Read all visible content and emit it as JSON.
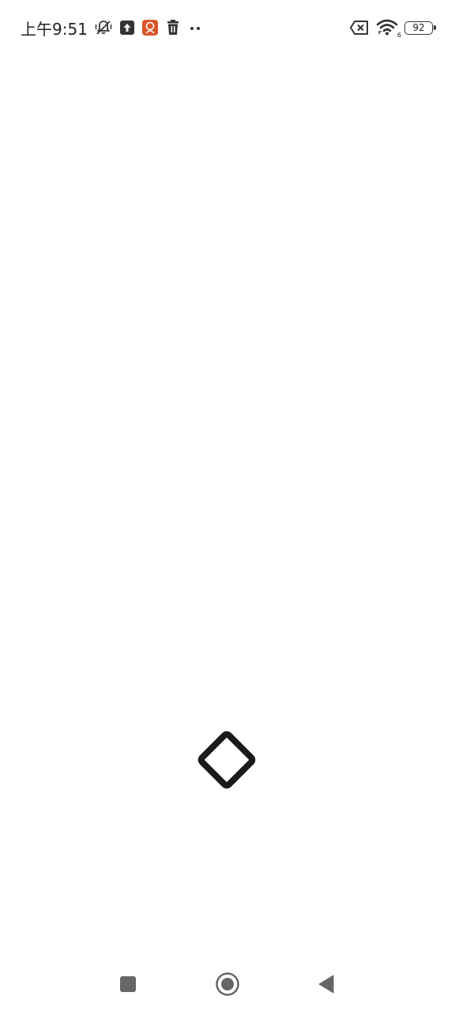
{
  "status_bar": {
    "time": "上午9:51",
    "battery_level": "92",
    "wifi_generation": "6",
    "icons": [
      "mute-vibrate-icon",
      "upload-icon",
      "app-notification-icon",
      "trash-icon",
      "more-dots-icon",
      "sim-error-icon",
      "wifi-icon",
      "battery-icon"
    ],
    "more_label": "··"
  },
  "colors": {
    "background": "#ffffff",
    "foreground": "#1a1a1a",
    "app_icon_accent": "#d9562b",
    "nav_icon": "#666666"
  },
  "navigation": {
    "buttons": [
      "recents-button",
      "home-button",
      "back-button"
    ]
  }
}
